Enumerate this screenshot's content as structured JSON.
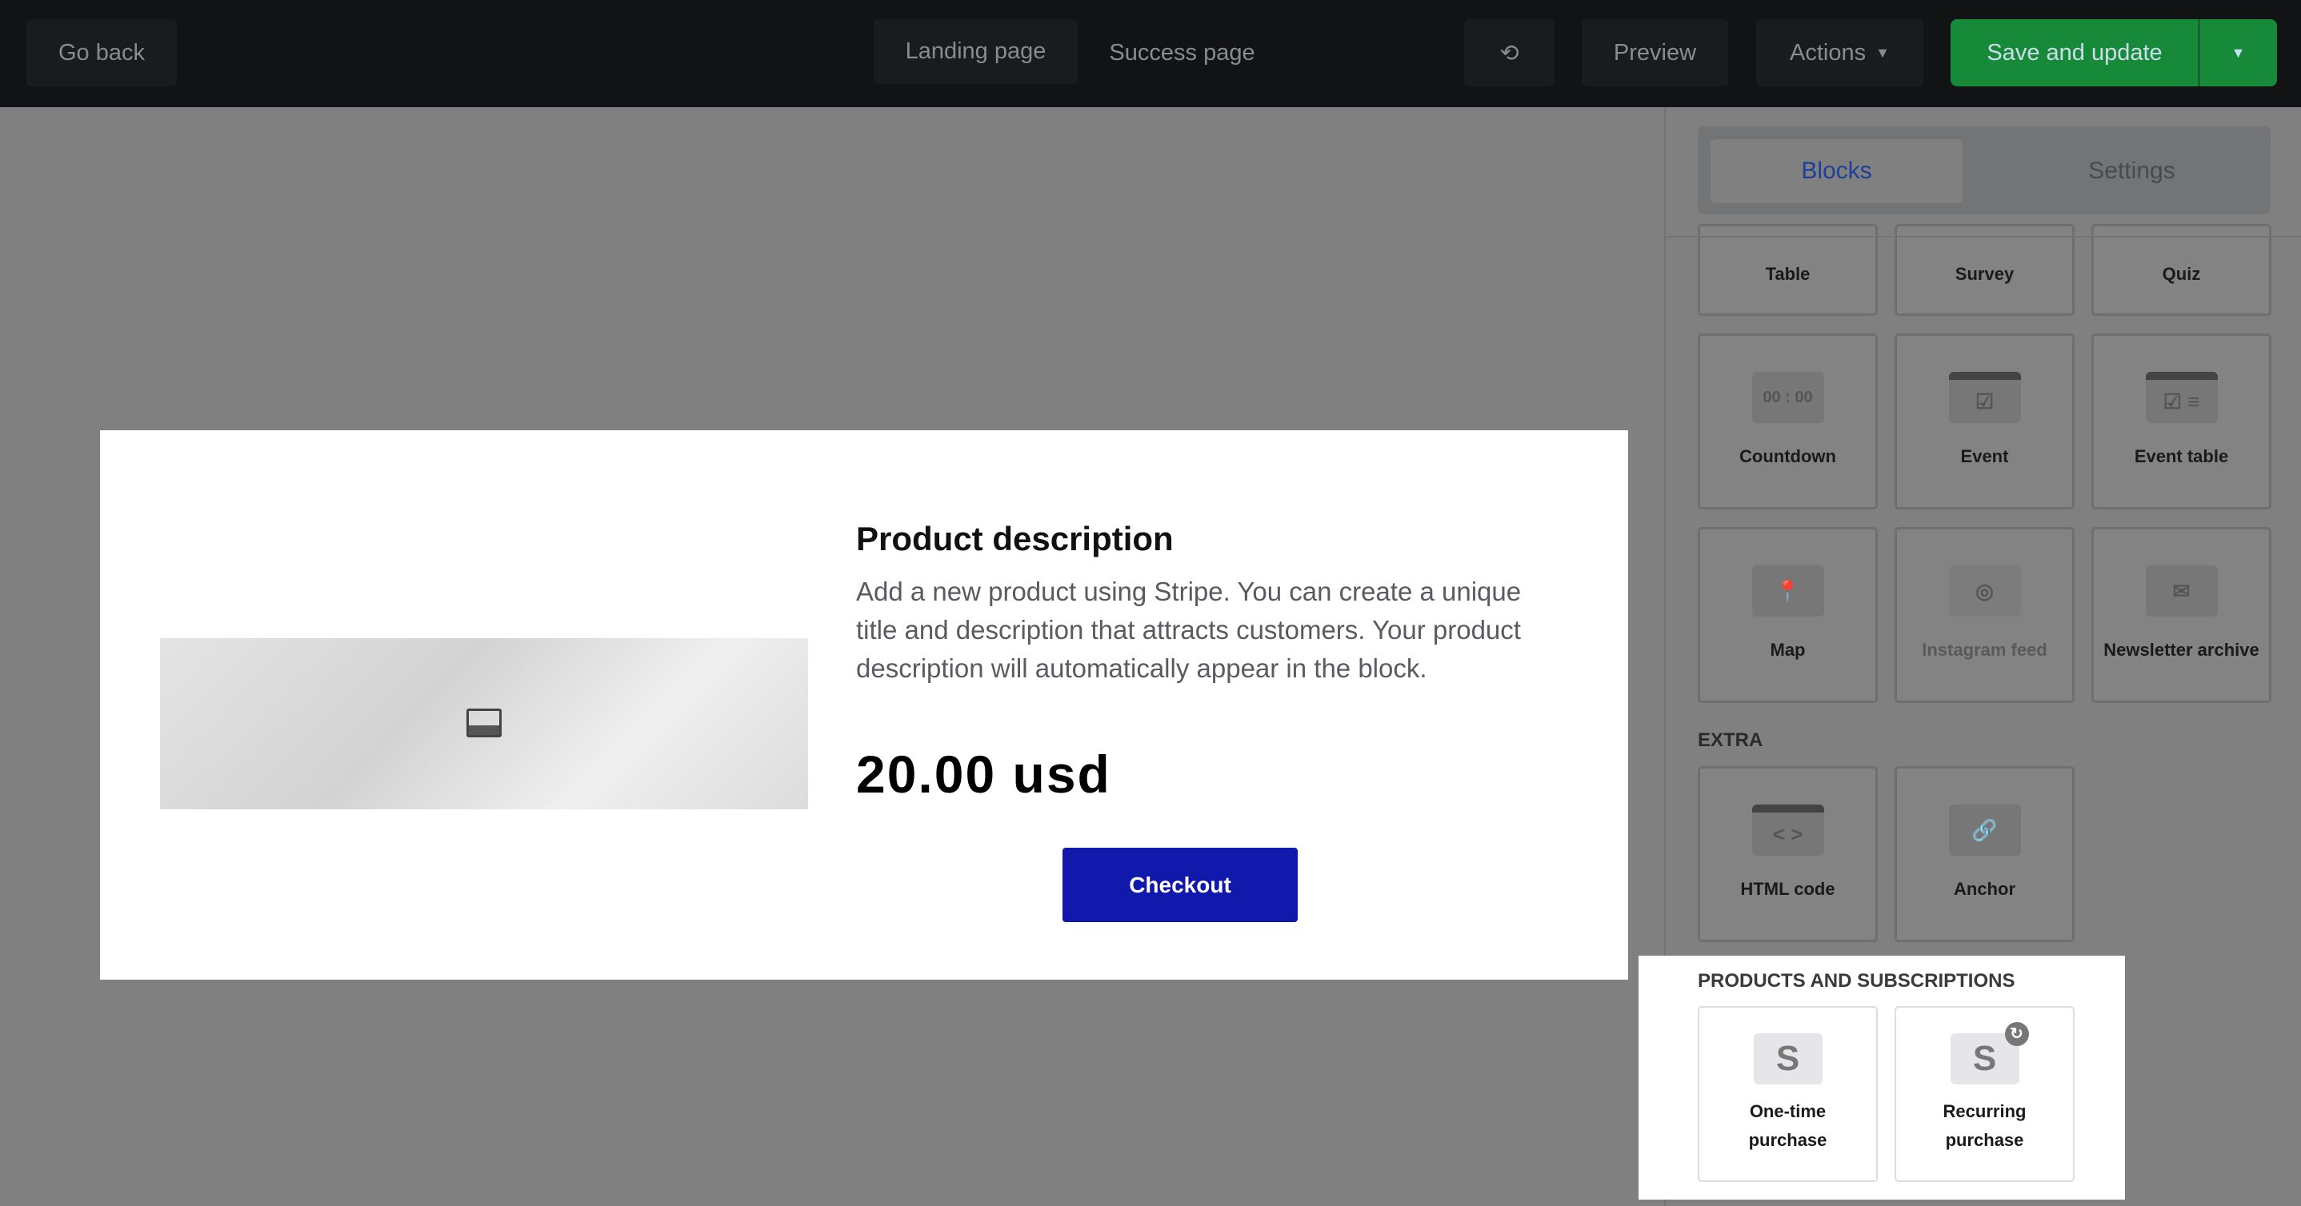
{
  "topbar": {
    "go_back": "Go back",
    "tabs": [
      "Landing page",
      "Success page"
    ],
    "history_icon": "history-icon",
    "preview": "Preview",
    "actions": "Actions",
    "save": "Save and update",
    "save_color": "#178a3a"
  },
  "product": {
    "title": "Product description",
    "description": "Add a new product using Stripe. You can create a unique title and description that attracts customers. Your product description will automatically appear in the block.",
    "price": "20.00 usd",
    "checkout": "Checkout",
    "checkout_color": "#1019ab"
  },
  "sidebar": {
    "tabs": [
      "Blocks",
      "Settings"
    ],
    "blocks": [
      {
        "label": "Table"
      },
      {
        "label": "Survey"
      },
      {
        "label": "Quiz"
      },
      {
        "label": "Countdown",
        "icon": "00 : 00"
      },
      {
        "label": "Event"
      },
      {
        "label": "Event table"
      },
      {
        "label": "Map"
      },
      {
        "label": "Instagram feed"
      },
      {
        "label": "Newsletter archive"
      }
    ],
    "extra_title": "EXTRA",
    "extra": [
      {
        "label": "HTML code",
        "icon": "< >"
      },
      {
        "label": "Anchor",
        "icon": "🔗"
      }
    ],
    "products_title": "PRODUCTS AND SUBSCRIPTIONS",
    "products": [
      {
        "label": "One-time purchase",
        "icon": "S"
      },
      {
        "label": "Recurring purchase",
        "icon": "S"
      }
    ]
  }
}
